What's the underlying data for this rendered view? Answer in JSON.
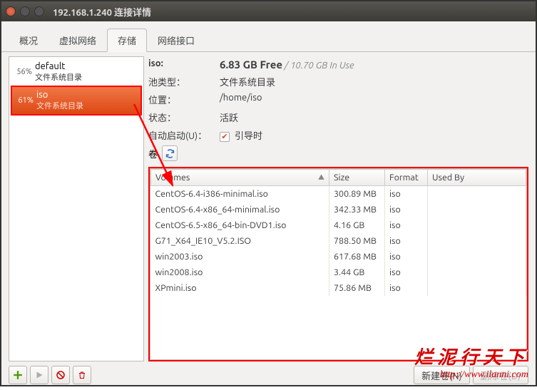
{
  "window": {
    "title": "192.168.1.240 连接详情"
  },
  "tabs": {
    "t0": "概况",
    "t1": "虚拟网络",
    "t2": "存储",
    "t3": "网络接口"
  },
  "sidebar": {
    "items": [
      {
        "pct": "56%",
        "name": "default",
        "sub": "文件系统目录"
      },
      {
        "pct": "61%",
        "name": "iso",
        "sub": "文件系统目录"
      }
    ]
  },
  "detail": {
    "name_label": "iso:",
    "free": "6.83 GB Free",
    "in_use": "/ 10.70 GB In Use",
    "pool_type_k": "池类型：",
    "pool_type_v": "文件系统目录",
    "location_k": "位置：",
    "location_v": "/home/iso",
    "state_k": "状态：",
    "state_v": "活跃",
    "autostart_k": "自动启动(U)：",
    "autostart_v": "引导时",
    "volumes_k": "卷"
  },
  "table": {
    "headers": {
      "c0": "Volumes",
      "c1": "Size",
      "c2": "Format",
      "c3": "Used By"
    },
    "rows": [
      {
        "n": "CentOS-6.4-i386-minimal.iso",
        "s": "300.89 MB",
        "f": "iso",
        "u": ""
      },
      {
        "n": "CentOS-6.4-x86_64-minimal.iso",
        "s": "342.33 MB",
        "f": "iso",
        "u": ""
      },
      {
        "n": "CentOS-6.5-x86_64-bin-DVD1.iso",
        "s": "4.16 GB",
        "f": "iso",
        "u": ""
      },
      {
        "n": "G71_X64_IE10_V5.2.ISO",
        "s": "788.50 MB",
        "f": "iso",
        "u": ""
      },
      {
        "n": "win2003.iso",
        "s": "617.68 MB",
        "f": "iso",
        "u": ""
      },
      {
        "n": "win2008.iso",
        "s": "3.44 GB",
        "f": "iso",
        "u": ""
      },
      {
        "n": "XPmini.iso",
        "s": "75.86 MB",
        "f": "iso",
        "u": ""
      }
    ]
  },
  "buttons": {
    "new_vol": "新建卷(N)",
    "del_vol": "删除卷(D)"
  },
  "watermark": {
    "cn": "烂泥行天下",
    "url": "http://www.ilanni.com"
  }
}
